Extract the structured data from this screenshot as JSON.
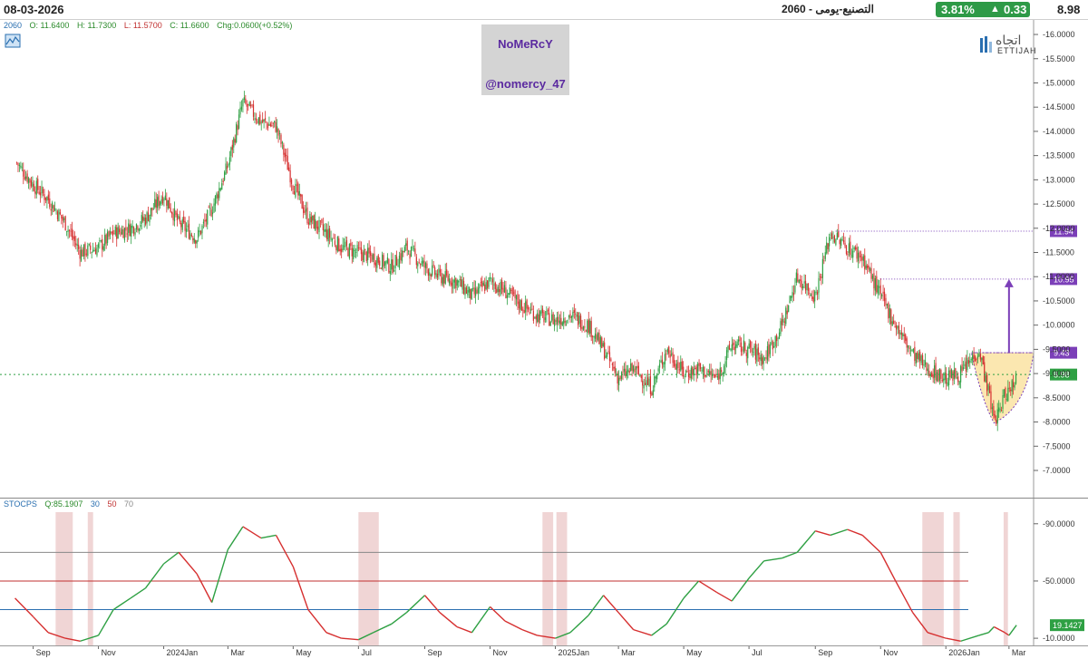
{
  "header": {
    "date": "08-03-2026",
    "symbol_title": "التصنيع-يومى -  2060",
    "price": "8.98",
    "change_pct": "3.81%",
    "change_abs": "0.33",
    "change_color": "#2e9a47"
  },
  "ohlc": {
    "symbol": "2060",
    "open": "O: 11.6400",
    "high": "H: 11.7300",
    "low": "L: 11.5700",
    "close": "C: 11.6600",
    "change": "Chg:0.0600(+0.52%)"
  },
  "watermark": {
    "line1": "NoMeRcY",
    "line2": "@nomercy_47"
  },
  "logo": {
    "arabic": "اتجاه",
    "english": "ETTIJAH"
  },
  "stoch_legend": {
    "name": "STOCPS",
    "q": "Q:85.1907",
    "l30": "30",
    "l50": "50",
    "l70": "70"
  },
  "colors": {
    "up": "#2ea043",
    "down": "#d62f2f",
    "purple": "#7b3fb8",
    "highlight": "#fbe7b0"
  },
  "chart_data": [
    {
      "type": "candlestick",
      "name": "price",
      "title": "",
      "x_ticks": [
        "Sep",
        "Nov",
        "2024Jan",
        "Mar",
        "May",
        "Jul",
        "Sep",
        "Nov",
        "2025Jan",
        "Mar",
        "May",
        "Jul",
        "Sep",
        "Nov",
        "2026Jan",
        "Mar"
      ],
      "y_ticks": [
        "16.0000",
        "15.5000",
        "15.0000",
        "14.5000",
        "14.0000",
        "13.5000",
        "13.0000",
        "12.5000",
        "12.0000",
        "11.5000",
        "11.0000",
        "10.5000",
        "10.0000",
        "9.5000",
        "9.0000",
        "8.5000",
        "8.0000",
        "7.5000",
        "7.0000"
      ],
      "ylim": [
        6.85,
        16.3
      ],
      "x": [
        "2023-08-15",
        "2023-09-01",
        "2023-09-15",
        "2023-10-01",
        "2023-10-15",
        "2023-11-01",
        "2023-11-15",
        "2023-12-01",
        "2023-12-15",
        "2024-01-01",
        "2024-01-15",
        "2024-02-01",
        "2024-02-15",
        "2024-03-01",
        "2024-03-15",
        "2024-04-01",
        "2024-04-15",
        "2024-05-01",
        "2024-05-15",
        "2024-06-01",
        "2024-06-15",
        "2024-07-01",
        "2024-07-15",
        "2024-08-01",
        "2024-08-15",
        "2024-09-01",
        "2024-09-15",
        "2024-10-01",
        "2024-10-15",
        "2024-11-01",
        "2024-11-15",
        "2024-12-01",
        "2024-12-15",
        "2025-01-01",
        "2025-01-15",
        "2025-02-01",
        "2025-02-15",
        "2025-03-01",
        "2025-03-15",
        "2025-04-01",
        "2025-04-15",
        "2025-05-01",
        "2025-05-15",
        "2025-06-01",
        "2025-06-15",
        "2025-07-01",
        "2025-07-15",
        "2025-08-01",
        "2025-08-15",
        "2025-09-01",
        "2025-09-15",
        "2025-10-01",
        "2025-10-15",
        "2025-11-01",
        "2025-11-15",
        "2025-12-01",
        "2025-12-15",
        "2026-01-01",
        "2026-01-15",
        "2026-02-01",
        "2026-02-10",
        "2026-02-15",
        "2026-02-20",
        "2026-02-25",
        "2026-03-01",
        "2026-03-08"
      ],
      "close": [
        13.4,
        12.9,
        12.6,
        12.1,
        11.5,
        11.6,
        11.9,
        12.0,
        12.2,
        12.7,
        12.1,
        11.8,
        12.4,
        13.3,
        14.6,
        14.2,
        14.1,
        12.9,
        12.2,
        11.9,
        11.6,
        11.5,
        11.4,
        11.2,
        11.6,
        11.2,
        11.0,
        10.9,
        10.6,
        10.9,
        10.7,
        10.4,
        10.2,
        10.1,
        10.2,
        10.0,
        9.5,
        8.9,
        9.1,
        8.7,
        9.5,
        9.0,
        9.1,
        8.9,
        9.6,
        9.5,
        9.3,
        10.0,
        11.0,
        10.6,
        11.9,
        11.6,
        11.4,
        10.6,
        10.0,
        9.4,
        9.1,
        8.9,
        9.0,
        9.5,
        8.6,
        8.05,
        8.2,
        8.6,
        8.65,
        8.98
      ],
      "levels": [
        11.94,
        10.95,
        9.43,
        8.98
      ],
      "arrow": {
        "from": 9.43,
        "to": 10.95
      }
    },
    {
      "type": "line",
      "name": "STOCPS",
      "y_ticks": [
        "90.0000",
        "50.0000",
        "10.0000"
      ],
      "current": "19.1427",
      "ylim": [
        5,
        100
      ],
      "levels": [
        30,
        50,
        70
      ],
      "x": [
        "2023-08-15",
        "2023-09-01",
        "2023-09-15",
        "2023-10-01",
        "2023-10-15",
        "2023-11-01",
        "2023-11-15",
        "2023-12-01",
        "2023-12-15",
        "2024-01-01",
        "2024-01-15",
        "2024-02-01",
        "2024-02-15",
        "2024-03-01",
        "2024-03-15",
        "2024-04-01",
        "2024-04-15",
        "2024-05-01",
        "2024-05-15",
        "2024-06-01",
        "2024-06-15",
        "2024-07-01",
        "2024-07-15",
        "2024-08-01",
        "2024-08-15",
        "2024-09-01",
        "2024-09-15",
        "2024-10-01",
        "2024-10-15",
        "2024-11-01",
        "2024-11-15",
        "2024-12-01",
        "2024-12-15",
        "2025-01-01",
        "2025-01-15",
        "2025-02-01",
        "2025-02-15",
        "2025-03-01",
        "2025-03-15",
        "2025-04-01",
        "2025-04-15",
        "2025-05-01",
        "2025-05-15",
        "2025-06-01",
        "2025-06-15",
        "2025-07-01",
        "2025-07-15",
        "2025-08-01",
        "2025-08-15",
        "2025-09-01",
        "2025-09-15",
        "2025-10-01",
        "2025-10-15",
        "2025-11-01",
        "2025-11-15",
        "2025-12-01",
        "2025-12-15",
        "2026-01-01",
        "2026-01-15",
        "2026-02-01",
        "2026-02-10",
        "2026-02-15",
        "2026-02-20",
        "2026-02-25",
        "2026-03-01",
        "2026-03-08"
      ],
      "values": [
        38,
        25,
        14,
        10,
        8,
        12,
        30,
        38,
        45,
        62,
        70,
        55,
        35,
        72,
        88,
        80,
        82,
        60,
        30,
        14,
        10,
        9,
        14,
        20,
        28,
        40,
        28,
        18,
        14,
        32,
        22,
        16,
        12,
        10,
        14,
        26,
        40,
        28,
        16,
        12,
        20,
        38,
        50,
        42,
        36,
        52,
        64,
        66,
        70,
        85,
        82,
        86,
        82,
        70,
        50,
        28,
        14,
        10,
        8,
        12,
        14,
        18,
        16,
        14,
        12,
        19.14
      ]
    }
  ]
}
